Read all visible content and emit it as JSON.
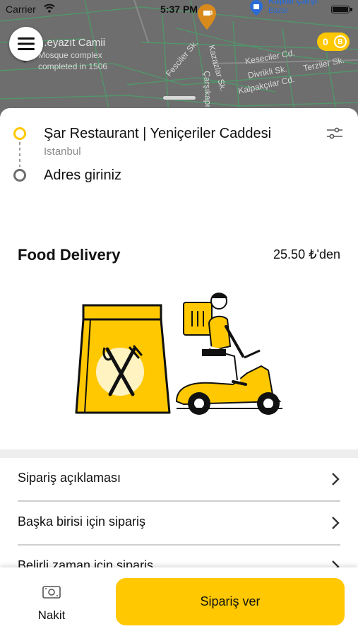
{
  "status_bar": {
    "carrier": "Carrier",
    "time": "5:37 PM"
  },
  "map": {
    "place_title": "...eyazıt Camii",
    "place_sub1": "Mosque complex",
    "place_sub2": "completed in 1506",
    "poi_name": "Kapalı Çarşı",
    "poi_sub": "Bazar",
    "streets": {
      "s1": "Fesciler Sk.",
      "s2": "Kazazlar Sk.",
      "s3": "Keseciler Cd.",
      "s4": "Divrikli Sk.",
      "s5": "Terziler Sk.",
      "s6": "Kalpakçılar Cd.",
      "s7": "Çarşıkapı Cd."
    }
  },
  "coins": {
    "count": "0",
    "icon_glyph": "B"
  },
  "route": {
    "origin_name": "Şar Restaurant | Yeniçeriler Caddesi",
    "origin_city": "Istanbul",
    "destination_placeholder": "Adres giriniz"
  },
  "service": {
    "name": "Food Delivery",
    "price": "25.50 ₺'den"
  },
  "options": [
    {
      "label": "Sipariş açıklaması"
    },
    {
      "label": "Başka birisi için sipariş"
    },
    {
      "label": "Belirli zaman için sipariş"
    }
  ],
  "bottom_bar": {
    "payment_label": "Nakit",
    "order_button": "Sipariş ver"
  },
  "colors": {
    "accent": "#ffc800",
    "map_gray": "#6e6e6e",
    "poi_blue": "#2a6bd6"
  }
}
